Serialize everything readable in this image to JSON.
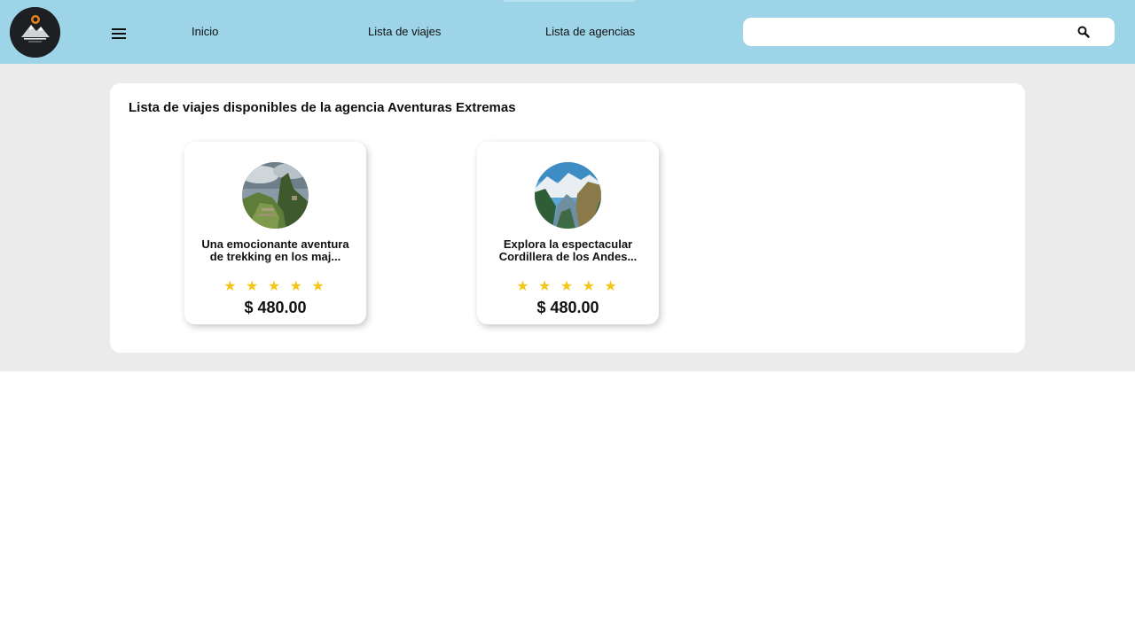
{
  "header": {
    "logo_icon": "mountain-logo-icon",
    "menu_icon": "hamburger-menu-icon",
    "nav": [
      {
        "label": "Inicio"
      },
      {
        "label": "Lista de viajes"
      },
      {
        "label": "Lista de agencias"
      }
    ],
    "search": {
      "placeholder": "",
      "value": "",
      "icon": "search-icon"
    },
    "background_color": "#9dd4e8"
  },
  "main": {
    "title": "Lista de viajes disponibles de la agencia Aventuras Extremas",
    "trips": [
      {
        "image_icon": "machu-picchu-photo",
        "title": "Una emocionante aventura de trekking en los maj...",
        "stars": "★ ★ ★ ★ ★",
        "rating": 5,
        "price": "$ 480.00"
      },
      {
        "image_icon": "andes-valley-photo",
        "title": "Explora la espectacular Cordillera de los Andes...",
        "stars": "★ ★ ★ ★ ★",
        "rating": 5,
        "price": "$ 480.00"
      }
    ]
  },
  "colors": {
    "star": "#f5c518",
    "page_background": "#ebebeb"
  }
}
